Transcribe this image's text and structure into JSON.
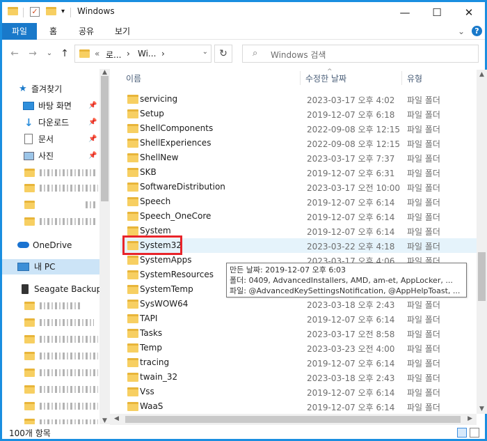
{
  "window": {
    "title": "Windows",
    "controls": {
      "minimize": "—",
      "maximize": "☐",
      "close": "✕"
    }
  },
  "ribbon": {
    "tabs": [
      "파일",
      "홈",
      "공유",
      "보기"
    ],
    "expand_glyph": "⌄",
    "help_glyph": "?"
  },
  "address": {
    "back_glyph": "←",
    "forward_glyph": "→",
    "recent_glyph": "⌄",
    "up_glyph": "↑",
    "crumbs": [
      "«",
      "로...",
      "›",
      "Wi...",
      "›"
    ],
    "dropdown_glyph": "⌄",
    "refresh_glyph": "↻",
    "search_placeholder": "Windows 검색",
    "search_glyph": "⌕"
  },
  "nav": {
    "quick_access": "즐겨찾기",
    "pinned": [
      {
        "label": "바탕 화면",
        "icon": "desktop-icon"
      },
      {
        "label": "다운로드",
        "icon": "download-icon"
      },
      {
        "label": "문서",
        "icon": "document-icon"
      },
      {
        "label": "사진",
        "icon": "pictures-icon"
      }
    ],
    "pin_glyph": "📌",
    "onedrive": "OneDrive",
    "this_pc": "내 PC",
    "drive": "Seagate Backup P"
  },
  "columns": {
    "name": "이름",
    "date": "수정한 날짜",
    "type": "유형",
    "sort_glyph": "^"
  },
  "files": [
    {
      "name": "servicing",
      "date": "2023-03-17 오후 4:02",
      "type": "파일 폴더"
    },
    {
      "name": "Setup",
      "date": "2019-12-07 오후 6:18",
      "type": "파일 폴더"
    },
    {
      "name": "ShellComponents",
      "date": "2022-09-08 오후 12:15",
      "type": "파일 폴더"
    },
    {
      "name": "ShellExperiences",
      "date": "2022-09-08 오후 12:15",
      "type": "파일 폴더"
    },
    {
      "name": "ShellNew",
      "date": "2023-03-17 오후 7:37",
      "type": "파일 폴더"
    },
    {
      "name": "SKB",
      "date": "2019-12-07 오후 6:31",
      "type": "파일 폴더"
    },
    {
      "name": "SoftwareDistribution",
      "date": "2023-03-17 오전 10:00",
      "type": "파일 폴더"
    },
    {
      "name": "Speech",
      "date": "2019-12-07 오후 6:14",
      "type": "파일 폴더"
    },
    {
      "name": "Speech_OneCore",
      "date": "2019-12-07 오후 6:14",
      "type": "파일 폴더"
    },
    {
      "name": "System",
      "date": "2019-12-07 오후 6:14",
      "type": "파일 폴더"
    },
    {
      "name": "System32",
      "date": "2023-03-22 오후 4:18",
      "type": "파일 폴더"
    },
    {
      "name": "SystemApps",
      "date": "2023-03-17 오후 4:06",
      "type": "파일 폴더"
    },
    {
      "name": "SystemResources",
      "date": "",
      "type": ""
    },
    {
      "name": "SystemTemp",
      "date": "",
      "type": ""
    },
    {
      "name": "SysWOW64",
      "date": "2023-03-18 오후 2:43",
      "type": "파일 폴더"
    },
    {
      "name": "TAPI",
      "date": "2019-12-07 오후 6:14",
      "type": "파일 폴더"
    },
    {
      "name": "Tasks",
      "date": "2023-03-17 오전 8:58",
      "type": "파일 폴더"
    },
    {
      "name": "Temp",
      "date": "2023-03-23 오전 4:00",
      "type": "파일 폴더"
    },
    {
      "name": "tracing",
      "date": "2019-12-07 오후 6:14",
      "type": "파일 폴더"
    },
    {
      "name": "twain_32",
      "date": "2023-03-18 오후 2:43",
      "type": "파일 폴더"
    },
    {
      "name": "Vss",
      "date": "2019-12-07 오후 6:14",
      "type": "파일 폴더"
    },
    {
      "name": "WaaS",
      "date": "2019-12-07 오후 6:14",
      "type": "파일 폴더"
    }
  ],
  "tooltip": {
    "line1": "만든 날짜: 2019-12-07 오후 6:03",
    "line2": "폴더: 0409, AdvancedInstallers, AMD, am-et, AppLocker, ...",
    "line3": "파일: @AdvancedKeySettingsNotification, @AppHelpToast, ..."
  },
  "status": {
    "count": "100개 항목"
  },
  "colors": {
    "accent": "#1979ca",
    "highlight": "#e8242a",
    "folder": "#f7cf62"
  }
}
